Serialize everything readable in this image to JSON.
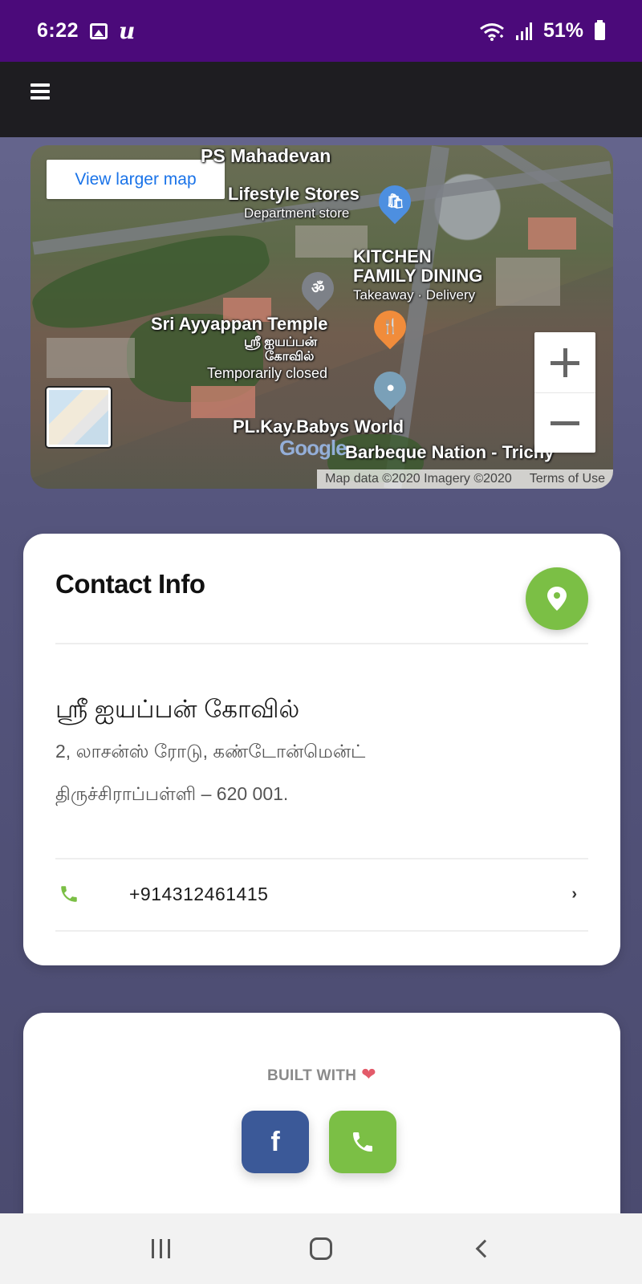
{
  "status_bar": {
    "time": "6:22",
    "battery_percent": "51%",
    "icons": [
      "gallery-icon",
      "u-app-icon",
      "wifi-icon",
      "signal-icon",
      "battery-icon"
    ],
    "background": "#4b0a7a"
  },
  "app_bar": {
    "menu_icon": "hamburger-menu-icon",
    "background": "#1e1d21"
  },
  "map": {
    "view_larger_label": "View larger map",
    "labels": {
      "ps_mahadevan": "PS Mahadevan",
      "lifestyle": "Lifestyle Stores",
      "lifestyle_sub": "Department store",
      "kitchen1": "KITCHEN",
      "kitchen2": "FAMILY DINING",
      "kitchen_sub": "Takeaway · Delivery",
      "temple": "Sri Ayyappan Temple",
      "temple_ta1": "ஸ்ரீ ஐயப்பன்",
      "temple_ta2": "கோவில்",
      "temple_status": "Temporarily closed",
      "babys_world": "PL.Kay.Babys World",
      "barbeque": "Barbeque Nation - Trichy",
      "google": "Google"
    },
    "footer": {
      "map_data": "Map data ©2020 Imagery ©2020",
      "terms": "Terms of Use"
    }
  },
  "contact": {
    "title": "Contact Info",
    "place_name": "ஸ்ரீ ஐயப்பன் கோவில்",
    "address_line1": "2, லாசன்ஸ் ரோடு, கண்டோன்மென்ட்",
    "address_line2": "திருச்சிராப்பள்ளி – 620 001.",
    "phone": "+914312461415",
    "accent_color": "#7bbf45"
  },
  "footer": {
    "built_with": "BUILT WITH",
    "heart_icon": "heart-icon",
    "facebook_label": "f",
    "facebook_color": "#3b5998",
    "call_color": "#7bbf45"
  },
  "nav_bar": {
    "icons": [
      "recents-icon",
      "home-icon",
      "back-icon"
    ]
  }
}
